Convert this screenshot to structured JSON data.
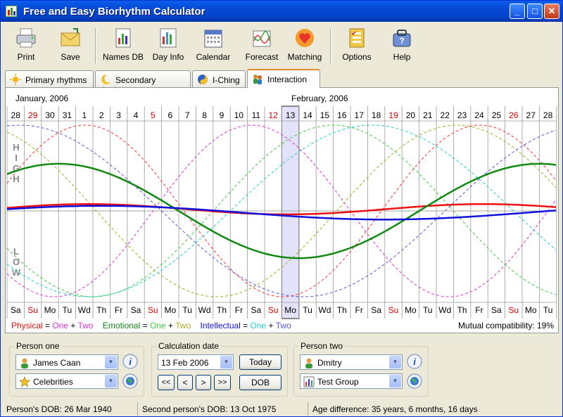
{
  "window": {
    "title": "Free and Easy Biorhythm Calculator"
  },
  "toolbar": [
    {
      "label": "Print",
      "icon": "printer-icon"
    },
    {
      "label": "Save",
      "icon": "save-envelope-icon"
    },
    {
      "label": "Names DB",
      "icon": "names-db-icon"
    },
    {
      "label": "Day Info",
      "icon": "day-info-icon"
    },
    {
      "label": "Calendar",
      "icon": "calendar-icon"
    },
    {
      "label": "Forecast",
      "icon": "forecast-icon"
    },
    {
      "label": "Matching",
      "icon": "matching-hearts-icon"
    },
    {
      "label": "Options",
      "icon": "options-checklist-icon"
    },
    {
      "label": "Help",
      "icon": "help-icon"
    }
  ],
  "tabs": [
    {
      "label": "Primary rhythms",
      "icon": "sun-icon"
    },
    {
      "label": "Secondary rhythms",
      "icon": "moon-icon"
    },
    {
      "label": "I-Ching",
      "icon": "yin-yang-icon"
    },
    {
      "label": "Interaction",
      "icon": "people-icon",
      "active": true
    }
  ],
  "chart": {
    "month_left": "January, 2006",
    "month_right": "February, 2006",
    "axis_high": "HIGH",
    "axis_low": "LOW",
    "days": [
      "28",
      "29",
      "30",
      "31",
      "1",
      "2",
      "3",
      "4",
      "5",
      "6",
      "7",
      "8",
      "9",
      "10",
      "11",
      "12",
      "13",
      "14",
      "15",
      "16",
      "17",
      "18",
      "19",
      "20",
      "21",
      "22",
      "23",
      "24",
      "25",
      "26",
      "27",
      "28"
    ],
    "weekdays": [
      "Sa",
      "Su",
      "Mo",
      "Tu",
      "Wd",
      "Th",
      "Fr",
      "Sa",
      "Su",
      "Mo",
      "Tu",
      "Wd",
      "Th",
      "Fr",
      "Sa",
      "Su",
      "Mo",
      "Tu",
      "Wd",
      "Th",
      "Fr",
      "Sa",
      "Su",
      "Mo",
      "Tu",
      "Wd",
      "Th",
      "Fr",
      "Sa",
      "Su",
      "Mo",
      "Tu"
    ],
    "sundays_red": [
      1,
      8,
      15,
      22,
      29
    ],
    "selected_index": 16,
    "legend": {
      "physical": "Physical = One + Two",
      "emotional": "Emotional = One + Two",
      "intellectual": "Intellectual = One + Two"
    },
    "compatibility": "Mutual compatibility: 19%",
    "colors": {
      "physical": "#ee1111",
      "emotional": "#118811",
      "intellectual": "#1111dd",
      "p1": "#ff3333",
      "p2": "#dd33dd",
      "e1": "#44cc44",
      "e2": "#aaaa22",
      "i1": "#22cccc",
      "i2": "#5555dd",
      "sunday": "#dd0000",
      "selected": "#e2e2fa"
    }
  },
  "person_one": {
    "label": "Person one",
    "name": "James Caan",
    "group": "Celebrities"
  },
  "calc_date": {
    "label": "Calculation date",
    "value": "13 Feb 2006",
    "today": "Today",
    "dob": "DOB",
    "nav": [
      "<<",
      "<",
      ">",
      ">>"
    ]
  },
  "person_two": {
    "label": "Person two",
    "name": "Dmitry",
    "group": "Test Group"
  },
  "status": {
    "dob1": "Person's DOB: 26 Mar 1940",
    "dob2": "Second person's DOB: 13 Oct 1975",
    "age_diff": "Age difference: 35 years, 6 months, 16 days"
  }
}
